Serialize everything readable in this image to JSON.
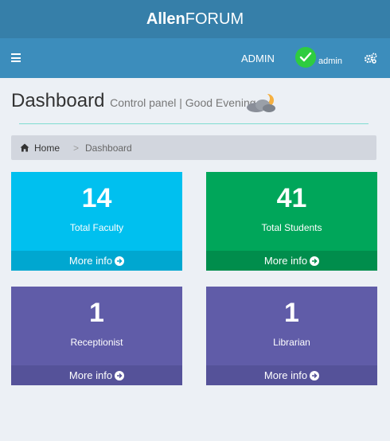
{
  "brand": {
    "bold": "Allen",
    "rest": "FORUM"
  },
  "navbar": {
    "user_label": "ADMIN",
    "avatar_name": "admin"
  },
  "header": {
    "title": "Dashboard",
    "subtitle": "Control panel | Good Evening !"
  },
  "breadcrumb": {
    "home": "Home",
    "separator": ">",
    "current": "Dashboard"
  },
  "boxes": [
    {
      "count": "14",
      "label": "Total Faculty",
      "more": "More info",
      "color": "#00c0ef"
    },
    {
      "count": "41",
      "label": "Total Students",
      "more": "More info",
      "color": "#00a65a"
    },
    {
      "count": "1",
      "label": "Receptionist",
      "more": "More info",
      "color": "#605ca8"
    },
    {
      "count": "1",
      "label": "Librarian",
      "more": "More info",
      "color": "#605ca8"
    }
  ],
  "icons": [
    "menu-icon",
    "check-icon",
    "gears-icon",
    "moon-cloud-icon",
    "home-icon",
    "arrow-circle-right-icon"
  ]
}
